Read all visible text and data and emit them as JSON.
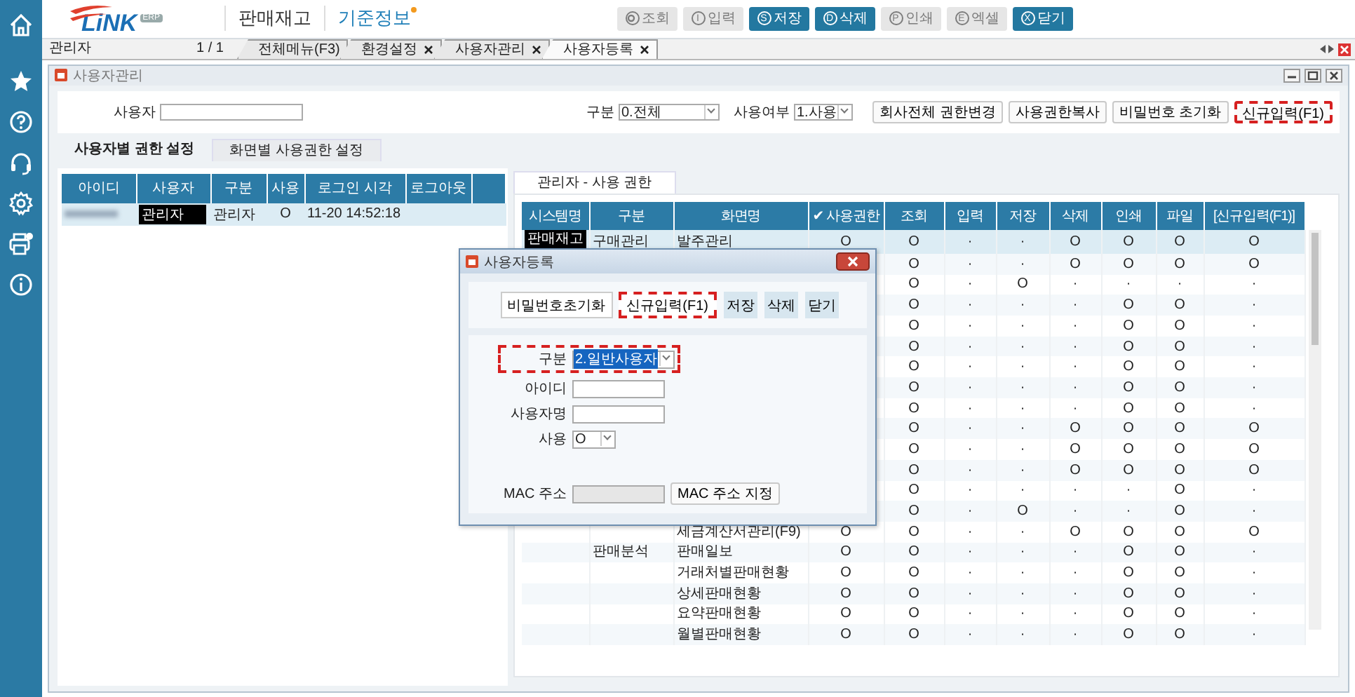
{
  "sidebar": [
    {
      "kind": "home"
    },
    {
      "kind": "star"
    },
    {
      "kind": "help"
    },
    {
      "kind": "headset"
    },
    {
      "kind": "settings"
    },
    {
      "kind": "printer"
    },
    {
      "kind": "info"
    }
  ],
  "header": {
    "logo": {
      "text": "LiNK",
      "badge": "ERP"
    },
    "menus": [
      {
        "label": "판매재고",
        "selected": false,
        "new": false
      },
      {
        "label": "기준정보",
        "selected": true,
        "new": true
      }
    ],
    "toolbar": [
      {
        "label": "조회",
        "disabled": true
      },
      {
        "key": "I",
        "label": "입력",
        "disabled": true
      },
      {
        "key": "S",
        "label": "저장",
        "disabled": false
      },
      {
        "key": "D",
        "label": "삭제",
        "disabled": false
      },
      {
        "key": "P",
        "label": "인쇄",
        "disabled": true
      },
      {
        "key": "E",
        "label": "엑셀",
        "disabled": true
      },
      {
        "key": "X",
        "label": "닫기",
        "disabled": false
      }
    ]
  },
  "tabbar": {
    "user": "관리자",
    "pager": "1 / 1",
    "tabs": [
      {
        "label": "전체메뉴(F3)",
        "closable": false,
        "selected": false
      },
      {
        "label": "환경설정",
        "closable": true,
        "selected": false
      },
      {
        "label": "사용자관리",
        "closable": true,
        "selected": false
      },
      {
        "label": "사용자등록",
        "closable": true,
        "selected": true
      }
    ]
  },
  "window": {
    "title": "사용자관리",
    "search": [
      {
        "kind": "text",
        "label": "사용자"
      },
      {
        "kind": "select",
        "label": "구분",
        "value": "0.전체"
      },
      {
        "kind": "select",
        "label": "사용여부",
        "value": "1.사용"
      }
    ],
    "buttons": [
      {
        "label": "회사전체 권한변경",
        "highlighted": false
      },
      {
        "label": "사용권한복사",
        "highlighted": false
      },
      {
        "label": "비밀번호 초기화",
        "highlighted": false
      },
      {
        "label": "신규입력(F1)",
        "highlighted": true
      }
    ]
  },
  "left_tabs": [
    {
      "label": "사용자별 권한 설정",
      "selected": true
    },
    {
      "label": "화면별 사용권한 설정",
      "selected": false
    }
  ],
  "users_table": {
    "columns": [
      "아이디",
      "사용자",
      "구분",
      "사용",
      "로그인 시각",
      "로그아웃"
    ],
    "rows": [
      {
        "id_blurred": true,
        "user": "관리자",
        "user_redacted": true,
        "group": "관리자",
        "use": "O",
        "login": "11-20 14:52:18",
        "selected": true
      }
    ]
  },
  "permissions": {
    "tab": "관리자 - 사용 권한",
    "columns": [
      "시스템명",
      "구분",
      "화면명",
      "✔ 사용권한",
      "조회",
      "입력",
      "저장",
      "삭제",
      "인쇄",
      "파일",
      "[신규입력(F1)]"
    ],
    "rows": [
      {
        "system": "판매재고",
        "system_redacted": true,
        "group": "구매관리",
        "screen": "발주관리",
        "use": "O",
        "marks": [
          "O",
          "·",
          "·",
          "O",
          "O",
          "O",
          "O"
        ],
        "selected": true
      },
      {
        "marks": [
          "O",
          "·",
          "·",
          "O",
          "O",
          "O",
          "O"
        ],
        "selected": false
      },
      {
        "marks": [
          "O",
          "·",
          "O",
          "·",
          "·",
          "·",
          "·"
        ],
        "selected": false
      },
      {
        "marks": [
          "O",
          "·",
          "·",
          "·",
          "O",
          "O",
          "·"
        ],
        "selected": false
      },
      {
        "marks": [
          "O",
          "·",
          "·",
          "·",
          "O",
          "O",
          "·"
        ],
        "selected": false
      },
      {
        "marks": [
          "O",
          "·",
          "·",
          "·",
          "O",
          "O",
          "·"
        ],
        "selected": false
      },
      {
        "marks": [
          "O",
          "·",
          "·",
          "·",
          "O",
          "O",
          "·"
        ],
        "selected": false
      },
      {
        "marks": [
          "O",
          "·",
          "·",
          "·",
          "O",
          "O",
          "·"
        ],
        "selected": false
      },
      {
        "marks": [
          "O",
          "·",
          "·",
          "·",
          "O",
          "O",
          "·"
        ],
        "selected": false
      },
      {
        "marks": [
          "O",
          "·",
          "·",
          "O",
          "O",
          "O",
          "O"
        ],
        "selected": false
      },
      {
        "marks": [
          "O",
          "·",
          "·",
          "O",
          "O",
          "O",
          "O"
        ],
        "selected": false
      },
      {
        "marks": [
          "O",
          "·",
          "·",
          "O",
          "O",
          "O",
          "O"
        ],
        "selected": false
      },
      {
        "marks": [
          "O",
          "·",
          "·",
          "·",
          "·",
          "O",
          "·"
        ],
        "selected": false
      },
      {
        "marks": [
          "O",
          "·",
          "O",
          "·",
          "·",
          "O",
          "·"
        ],
        "selected": false
      },
      {
        "screen": "세금계산서관리(F9)",
        "use": "O",
        "marks": [
          "O",
          "·",
          "·",
          "O",
          "O",
          "O",
          "O"
        ],
        "selected": false
      },
      {
        "group": "판매분석",
        "screen": "판매일보",
        "use": "O",
        "marks": [
          "O",
          "·",
          "·",
          "·",
          "O",
          "O",
          "·"
        ],
        "selected": false
      },
      {
        "screen": "거래처별판매현황",
        "use": "O",
        "marks": [
          "O",
          "·",
          "·",
          "·",
          "O",
          "O",
          "·"
        ],
        "selected": false
      },
      {
        "screen": "상세판매현황",
        "use": "O",
        "marks": [
          "O",
          "·",
          "·",
          "·",
          "O",
          "O",
          "·"
        ],
        "selected": false
      },
      {
        "screen": "요약판매현황",
        "use": "O",
        "marks": [
          "O",
          "·",
          "·",
          "·",
          "O",
          "O",
          "·"
        ],
        "selected": false
      },
      {
        "screen": "월별판매현황",
        "use": "O",
        "marks": [
          "O",
          "·",
          "·",
          "·",
          "O",
          "O",
          "·"
        ],
        "selected": false
      }
    ]
  },
  "dialog": {
    "title": "사용자등록",
    "buttons": [
      {
        "label": "비밀번호초기화",
        "kind": "plain",
        "highlighted": false
      },
      {
        "label": "신규입력(F1)",
        "kind": "plain",
        "highlighted": true
      },
      {
        "label": "저장",
        "kind": "action",
        "highlighted": false
      },
      {
        "label": "삭제",
        "kind": "action",
        "highlighted": false
      },
      {
        "label": "닫기",
        "kind": "action",
        "highlighted": false
      }
    ],
    "fields": [
      {
        "kind": "select",
        "label": "구분",
        "value": "2.일반사용자",
        "highlighted": true,
        "selected": true
      },
      {
        "kind": "text",
        "label": "아이디",
        "highlighted": false
      },
      {
        "kind": "text",
        "label": "사용자명",
        "highlighted": false
      },
      {
        "kind": "select",
        "label": "사용",
        "value": "O",
        "highlighted": false,
        "selected": false
      }
    ],
    "mac": {
      "label": "MAC 주소",
      "disabled": true,
      "button": "MAC 주소 지정"
    }
  }
}
